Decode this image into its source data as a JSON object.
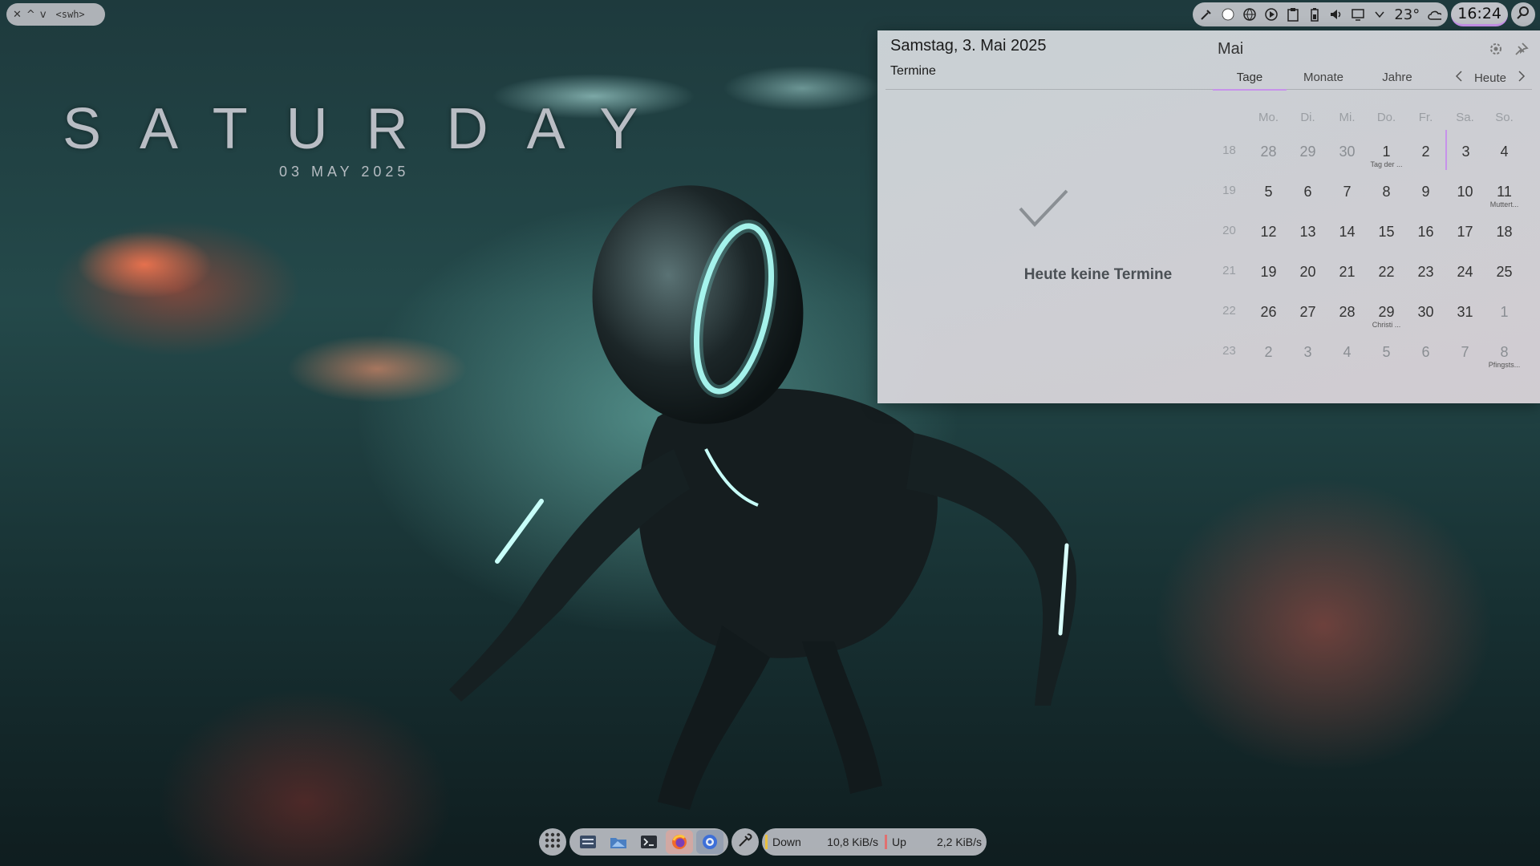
{
  "window_controls": {
    "close": "✕",
    "up": "^",
    "down": "v",
    "name": "<swh>"
  },
  "desktop_widget": {
    "day": "SATURDAY",
    "date": "03 MAY 2025"
  },
  "tray": {
    "temperature": "23°",
    "clock": "16:24"
  },
  "calendar_popup": {
    "date_heading": "Samstag, 3. Mai 2025",
    "agenda_label": "Termine",
    "no_events": "Heute keine Termine",
    "month": "Mai",
    "tabs": [
      "Tage",
      "Monate",
      "Jahre"
    ],
    "today_label": "Heute",
    "weekday_headers": [
      "Mo.",
      "Di.",
      "Mi.",
      "Do.",
      "Fr.",
      "Sa.",
      "So."
    ],
    "weeks": [
      {
        "week": "18",
        "days": [
          {
            "d": "28",
            "o": true
          },
          {
            "d": "29",
            "o": true
          },
          {
            "d": "30",
            "o": true
          },
          {
            "d": "1",
            "sub": "Tag der ..."
          },
          {
            "d": "2"
          },
          {
            "d": "3",
            "today": true
          },
          {
            "d": "4"
          }
        ]
      },
      {
        "week": "19",
        "days": [
          {
            "d": "5"
          },
          {
            "d": "6"
          },
          {
            "d": "7"
          },
          {
            "d": "8"
          },
          {
            "d": "9"
          },
          {
            "d": "10"
          },
          {
            "d": "11",
            "sub": "Muttert..."
          }
        ]
      },
      {
        "week": "20",
        "days": [
          {
            "d": "12"
          },
          {
            "d": "13"
          },
          {
            "d": "14"
          },
          {
            "d": "15"
          },
          {
            "d": "16"
          },
          {
            "d": "17"
          },
          {
            "d": "18"
          }
        ]
      },
      {
        "week": "21",
        "days": [
          {
            "d": "19"
          },
          {
            "d": "20"
          },
          {
            "d": "21"
          },
          {
            "d": "22"
          },
          {
            "d": "23"
          },
          {
            "d": "24"
          },
          {
            "d": "25"
          }
        ]
      },
      {
        "week": "22",
        "days": [
          {
            "d": "26"
          },
          {
            "d": "27"
          },
          {
            "d": "28"
          },
          {
            "d": "29",
            "sub": "Christi ..."
          },
          {
            "d": "30"
          },
          {
            "d": "31"
          },
          {
            "d": "1",
            "o": true
          }
        ]
      },
      {
        "week": "23",
        "days": [
          {
            "d": "2",
            "o": true
          },
          {
            "d": "3",
            "o": true
          },
          {
            "d": "4",
            "o": true
          },
          {
            "d": "5",
            "o": true
          },
          {
            "d": "6",
            "o": true
          },
          {
            "d": "7",
            "o": true
          },
          {
            "d": "8",
            "o": true,
            "sub": "Pfingsts..."
          }
        ]
      }
    ]
  },
  "network": {
    "down_label": "Down",
    "down_value": "10,8 KiB/s",
    "up_label": "Up",
    "up_value": "2,2 KiB/s",
    "down_color": "#e8c040",
    "up_color": "#e07070"
  },
  "colors": {
    "accent": "#c792ea"
  }
}
